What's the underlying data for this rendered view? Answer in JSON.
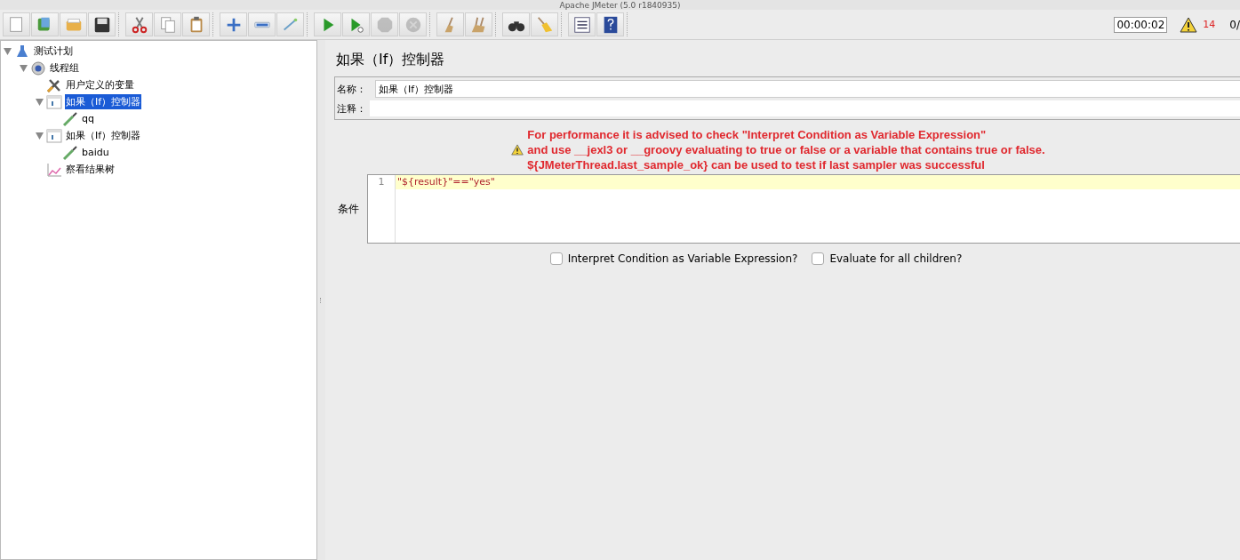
{
  "window": {
    "title": "Apache JMeter (5.0 r1840935)"
  },
  "toolbar": {
    "groups": [
      [
        {
          "kind": "new",
          "disabled": false
        },
        {
          "kind": "templates",
          "disabled": false
        },
        {
          "kind": "open",
          "disabled": false
        },
        {
          "kind": "save",
          "disabled": false
        }
      ],
      [
        {
          "kind": "cut",
          "disabled": false
        },
        {
          "kind": "copy",
          "disabled": false
        },
        {
          "kind": "paste",
          "disabled": false
        }
      ],
      [
        {
          "kind": "add",
          "disabled": false
        },
        {
          "kind": "remove",
          "disabled": false
        },
        {
          "kind": "toggle",
          "disabled": false
        }
      ],
      [
        {
          "kind": "start",
          "disabled": false
        },
        {
          "kind": "start-no-pause",
          "disabled": false
        },
        {
          "kind": "stop",
          "disabled": true
        },
        {
          "kind": "shutdown",
          "disabled": true
        }
      ],
      [
        {
          "kind": "clear",
          "disabled": false
        },
        {
          "kind": "clear-all",
          "disabled": false
        }
      ],
      [
        {
          "kind": "search",
          "disabled": false
        },
        {
          "kind": "reset-search",
          "disabled": false
        }
      ],
      [
        {
          "kind": "function-helper",
          "disabled": false
        },
        {
          "kind": "help",
          "disabled": false
        }
      ]
    ],
    "timer": "00:00:02",
    "error_count": "14",
    "threads": "0/"
  },
  "tree": [
    {
      "label": "测试计划",
      "kind": "plan",
      "expanded": true,
      "selected": false,
      "children": [
        {
          "label": "线程组",
          "kind": "thread-group",
          "expanded": true,
          "selected": false,
          "children": [
            {
              "label": "用户定义的变量",
              "kind": "config",
              "selected": false
            },
            {
              "label": "如果（If）控制器",
              "kind": "controller",
              "expanded": true,
              "selected": true,
              "children": [
                {
                  "label": "qq",
                  "kind": "sampler",
                  "selected": false
                }
              ]
            },
            {
              "label": "如果（If）控制器",
              "kind": "controller",
              "expanded": true,
              "selected": false,
              "children": [
                {
                  "label": "baidu",
                  "kind": "sampler",
                  "selected": false
                }
              ]
            },
            {
              "label": "察看结果树",
              "kind": "listener",
              "selected": false
            }
          ]
        }
      ]
    }
  ],
  "editor": {
    "title": "如果（If）控制器",
    "name_label": "名称：",
    "name_value": "如果（If）控制器",
    "comment_label": "注释：",
    "warning_lines": [
      "For performance it is advised to check \"Interpret Condition as Variable Expression\"",
      "and use __jexl3 or __groovy evaluating to true or false or a variable that contains true or false.",
      "${JMeterThread.last_sample_ok} can be used to test if last sampler was successful"
    ],
    "condition_label": "条件",
    "code_lines": [
      {
        "number": "1",
        "text": "\"${result}\"==\"yes\""
      }
    ],
    "checkboxes": [
      {
        "label": "Interpret Condition as Variable Expression?",
        "checked": false
      },
      {
        "label": "Evaluate for all children?",
        "checked": false
      }
    ]
  }
}
